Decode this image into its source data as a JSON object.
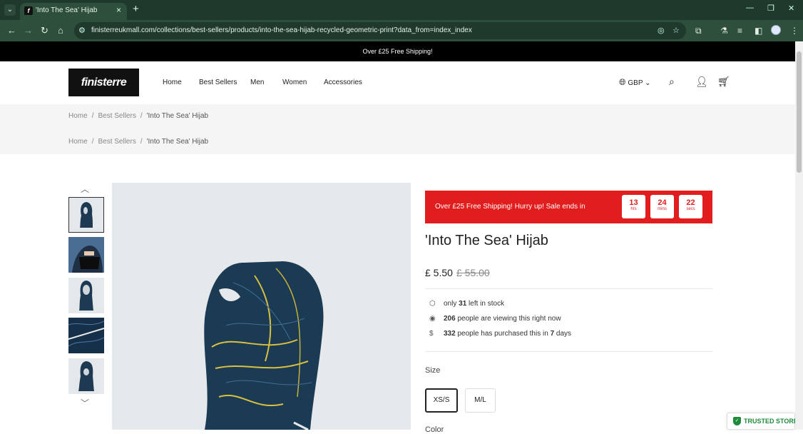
{
  "browser": {
    "tab_title": "'Into The Sea' Hijab",
    "favicon_letter": "f",
    "url": "finisterreukmall.com/collections/best-sellers/products/into-the-sea-hijab-recycled-geometric-print?data_from=index_index"
  },
  "announcement": "Over £25 Free Shipping!",
  "header": {
    "logo": "finisterre",
    "nav": [
      "Home",
      "Best Sellers",
      "Men",
      "Women",
      "Accessories"
    ],
    "currency": "GBP"
  },
  "breadcrumb": {
    "home": "Home",
    "category": "Best Sellers",
    "current": "'Into The Sea' Hijab",
    "separator": "/"
  },
  "product": {
    "sale_banner": "Over £25 Free Shipping!  Hurry up!  Sale ends in",
    "timer": [
      {
        "value": "13",
        "unit": "hrs"
      },
      {
        "value": "24",
        "unit": "mins"
      },
      {
        "value": "22",
        "unit": "secs"
      }
    ],
    "title": "'Into The Sea' Hijab",
    "price": "£ 5.50",
    "compare_price": "£ 55.00",
    "stock": {
      "pre": "only",
      "count": "31",
      "post": "left in stock"
    },
    "viewing": {
      "count": "206",
      "post": "people are viewing this right now"
    },
    "purchased": {
      "count": "332",
      "mid": "people has purchased this in",
      "days": "7",
      "post": "days"
    },
    "size_label": "Size",
    "sizes": [
      "XS/S",
      "M/L"
    ],
    "selected_size": "XS/S",
    "color_label": "Color"
  },
  "trusted_badge": "TRUSTED STORE",
  "colors": {
    "sale_red": "#e11d1d",
    "chrome_green": "#2e4f3c",
    "trusted_green": "#1e8a3c"
  }
}
